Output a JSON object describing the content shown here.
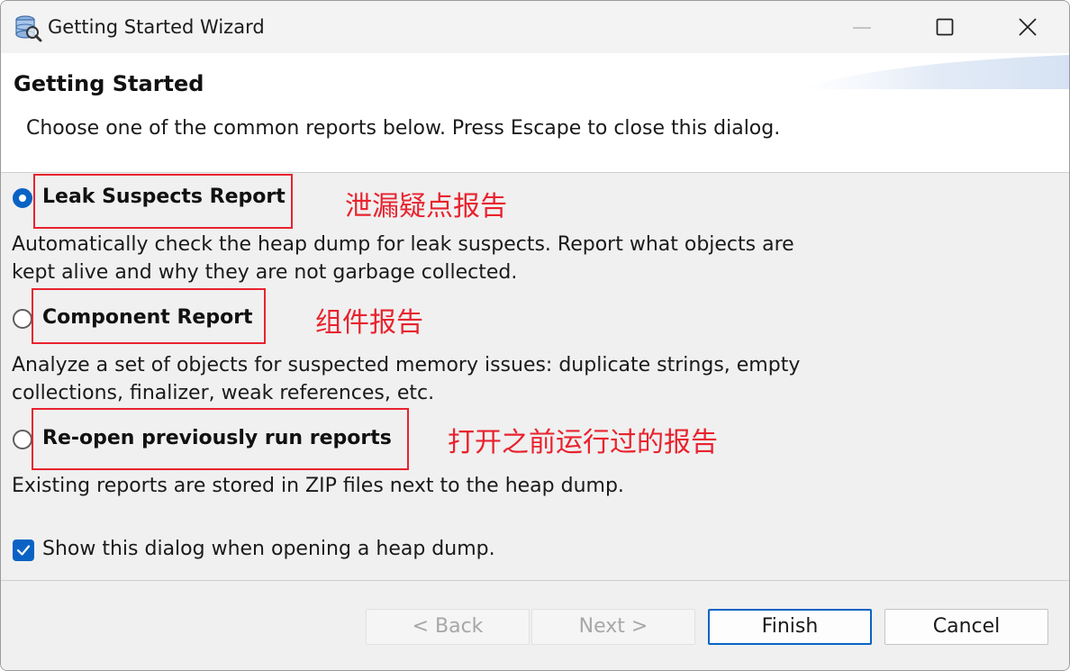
{
  "window": {
    "title": "Getting Started Wizard"
  },
  "header": {
    "title": "Getting Started",
    "description": "Choose one of the common reports below. Press Escape to close this dialog."
  },
  "options": [
    {
      "label": "Leak Suspects Report",
      "selected": true,
      "description_lines": [
        "Automatically check the heap dump for leak suspects. Report what objects are",
        "kept alive and why they are not garbage collected."
      ],
      "annotation": "泄漏疑点报告"
    },
    {
      "label": "Component Report",
      "selected": false,
      "description_lines": [
        "Analyze a set of objects for suspected memory issues: duplicate strings, empty",
        "collections, finalizer, weak references, etc."
      ],
      "annotation": "组件报告"
    },
    {
      "label": "Re-open previously run reports",
      "selected": false,
      "description_lines": [
        "Existing reports are stored in ZIP files next to the heap dump."
      ],
      "annotation": "打开之前运行过的报告"
    }
  ],
  "show_dialog": {
    "label": "Show this dialog when opening a heap dump.",
    "checked": true
  },
  "buttons": {
    "back": "< Back",
    "next": "Next >",
    "finish": "Finish",
    "cancel": "Cancel"
  },
  "colors": {
    "accent": "#0a63c4",
    "annotation_red": "#e8232e",
    "body_background": "#f0f0f0"
  }
}
